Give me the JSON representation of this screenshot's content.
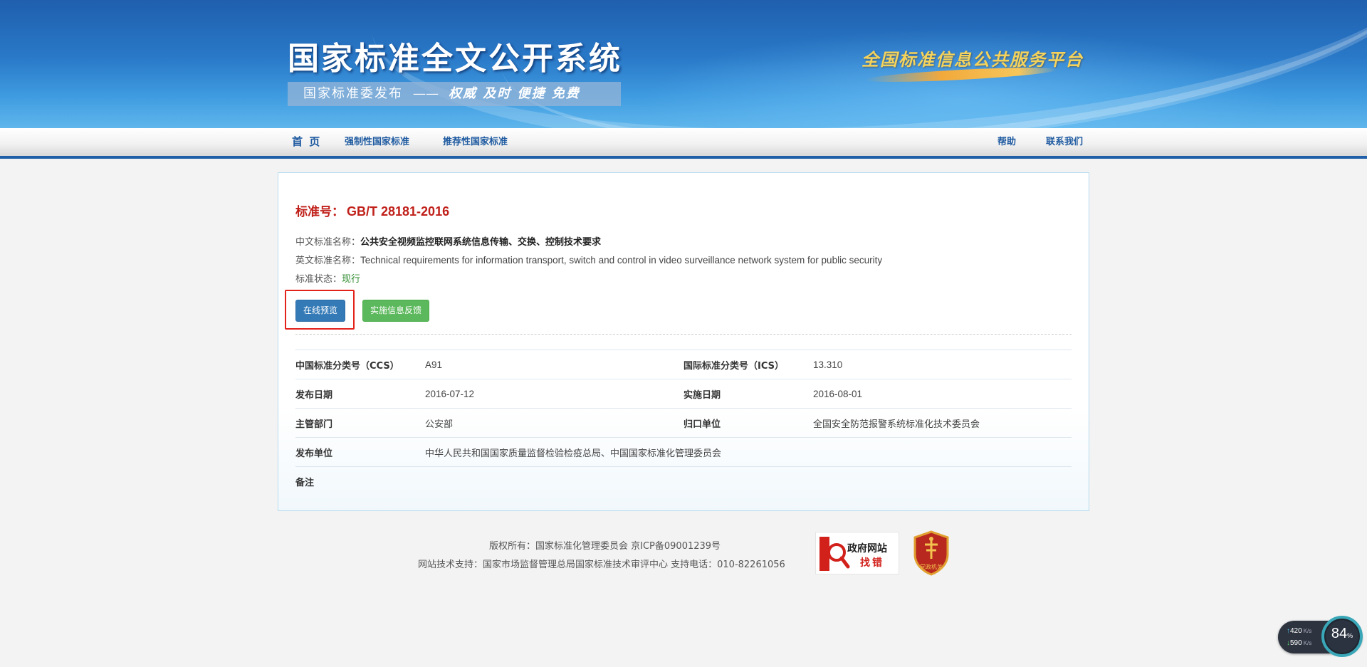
{
  "header": {
    "site_title": "国家标准全文公开系统",
    "subtitle_issuer": "国家标准委发布",
    "subtitle_separator": "——",
    "subtitle_motto": "权威  及时  便捷  免费",
    "platform_slogan": "全国标准信息公共服务平台"
  },
  "nav": {
    "home": "首 页",
    "mandatory": "强制性国家标准",
    "recommended": "推荐性国家标准",
    "help": "帮助",
    "contact": "联系我们"
  },
  "standard": {
    "number_label": "标准号：",
    "number": "GB/T 28181-2016",
    "cn_name_label": "中文标准名称：",
    "cn_name": "公共安全视频监控联网系统信息传输、交换、控制技术要求",
    "en_name_label": "英文标准名称：",
    "en_name": "Technical requirements for information transport, switch and control in video surveillance network system for public security",
    "status_label": "标准状态：",
    "status": "现行"
  },
  "buttons": {
    "preview": "在线预览",
    "feedback": "实施信息反馈"
  },
  "details": {
    "ccs_label": "中国标准分类号（CCS）",
    "ccs": "A91",
    "ics_label": "国际标准分类号（ICS）",
    "ics": "13.310",
    "publish_date_label": "发布日期",
    "publish_date": "2016-07-12",
    "implement_date_label": "实施日期",
    "implement_date": "2016-08-01",
    "competent_dept_label": "主管部门",
    "competent_dept": "公安部",
    "responsible_unit_label": "归口单位",
    "responsible_unit": "全国安全防范报警系统标准化技术委员会",
    "publisher_label": "发布单位",
    "publisher": "中华人民共和国国家质量监督检验检疫总局、中国国家标准化管理委员会",
    "remark_label": "备注",
    "remark": ""
  },
  "footer": {
    "copyright": "版权所有：国家标准化管理委员会 京ICP备09001239号",
    "support": "网站技术支持：国家市场监督管理总局国家标准技术审评中心 支持电话：010-82261056",
    "gov_badge_line1": "政府网站",
    "gov_badge_line2": "找错",
    "party_badge_text": "党政机关"
  },
  "speed_widget": {
    "upload": "420",
    "download": "590",
    "unit": "K/s",
    "percent": "84",
    "percent_sign": "%"
  },
  "colors": {
    "brand_blue": "#1e5fa8",
    "standard_red": "#c0201a",
    "status_green": "#2e8b2e",
    "btn_primary": "#337ab7",
    "btn_success": "#5cb85c",
    "highlight_red": "#e3221c"
  }
}
